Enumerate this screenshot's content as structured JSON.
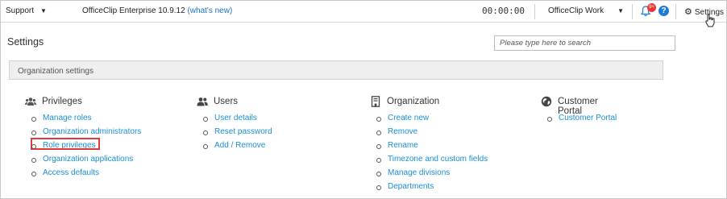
{
  "topbar": {
    "support_label": "Support",
    "product_label": "OfficeClip Enterprise 10.9.12",
    "whats_new_label": "(what's new)",
    "clock_text": "00:00:00",
    "workspace_label": "OfficeClip Work",
    "notification_count": "9+",
    "help_label": "?",
    "settings_label": "Settings"
  },
  "page": {
    "title": "Settings",
    "search_placeholder": "Please type here to search",
    "org_bar_label": "Organization settings"
  },
  "columns": [
    {
      "title": "Privileges",
      "icon": "users-group-icon",
      "items": [
        "Manage roles",
        "Organization administrators",
        "Role privileges",
        "Organization applications",
        "Access defaults"
      ]
    },
    {
      "title": "Users",
      "icon": "users-icon",
      "items": [
        "User details",
        "Reset password",
        "Add / Remove"
      ]
    },
    {
      "title": "Organization",
      "icon": "building-icon",
      "items": [
        "Create new",
        "Remove",
        "Rename",
        "Timezone and custom fields",
        "Manage divisions",
        "Departments"
      ]
    },
    {
      "title": "Customer Portal",
      "icon": "globe-icon",
      "items": [
        "Customer Portal"
      ]
    }
  ],
  "highlighted_item": "Role privileges",
  "colors": {
    "link": "#1a8fd1",
    "highlight": "#e03a3a",
    "badge": "#e53935",
    "help": "#1f7cd6"
  }
}
